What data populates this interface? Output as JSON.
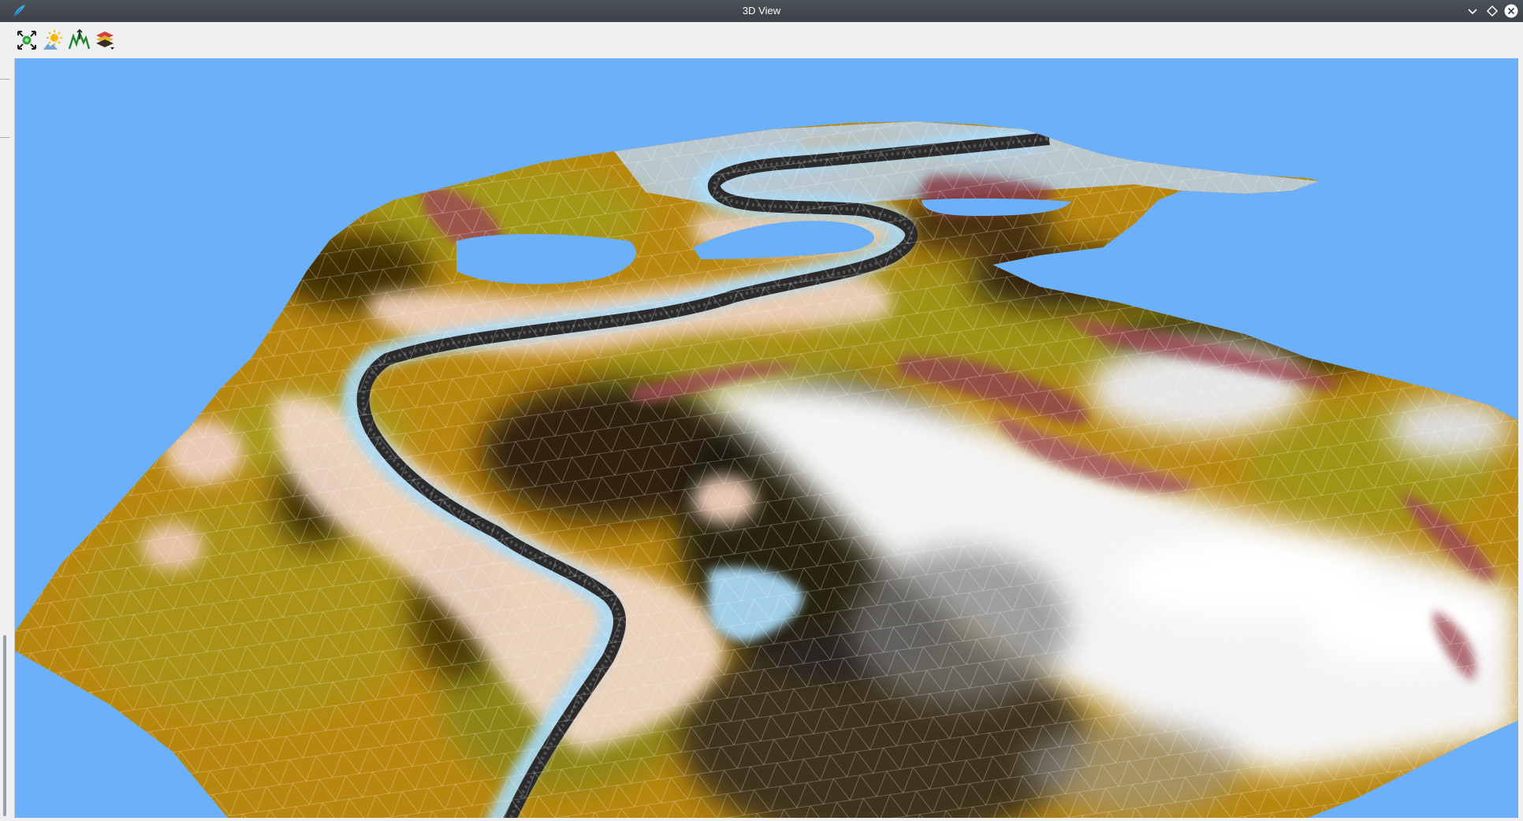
{
  "window": {
    "title": "3D View",
    "app_icon": "app-leaf-icon",
    "buttons": [
      "minimize-icon",
      "maximize-icon",
      "close-icon"
    ]
  },
  "toolbar": {
    "items": [
      {
        "icon": "camera-center-icon"
      },
      {
        "icon": "lighting-icon"
      },
      {
        "icon": "vertical-scale-icon"
      },
      {
        "icon": "layers-icon"
      }
    ]
  },
  "scene": {
    "sky_color": "#6cb0fa",
    "water_color": "#a9d9f5",
    "terrain_palette": [
      "#b8870f",
      "#a09418",
      "#6b5b0c",
      "#1a1208",
      "#efd6c4",
      "#9c4a55",
      "#ffffff",
      "#b9c4cc"
    ]
  }
}
